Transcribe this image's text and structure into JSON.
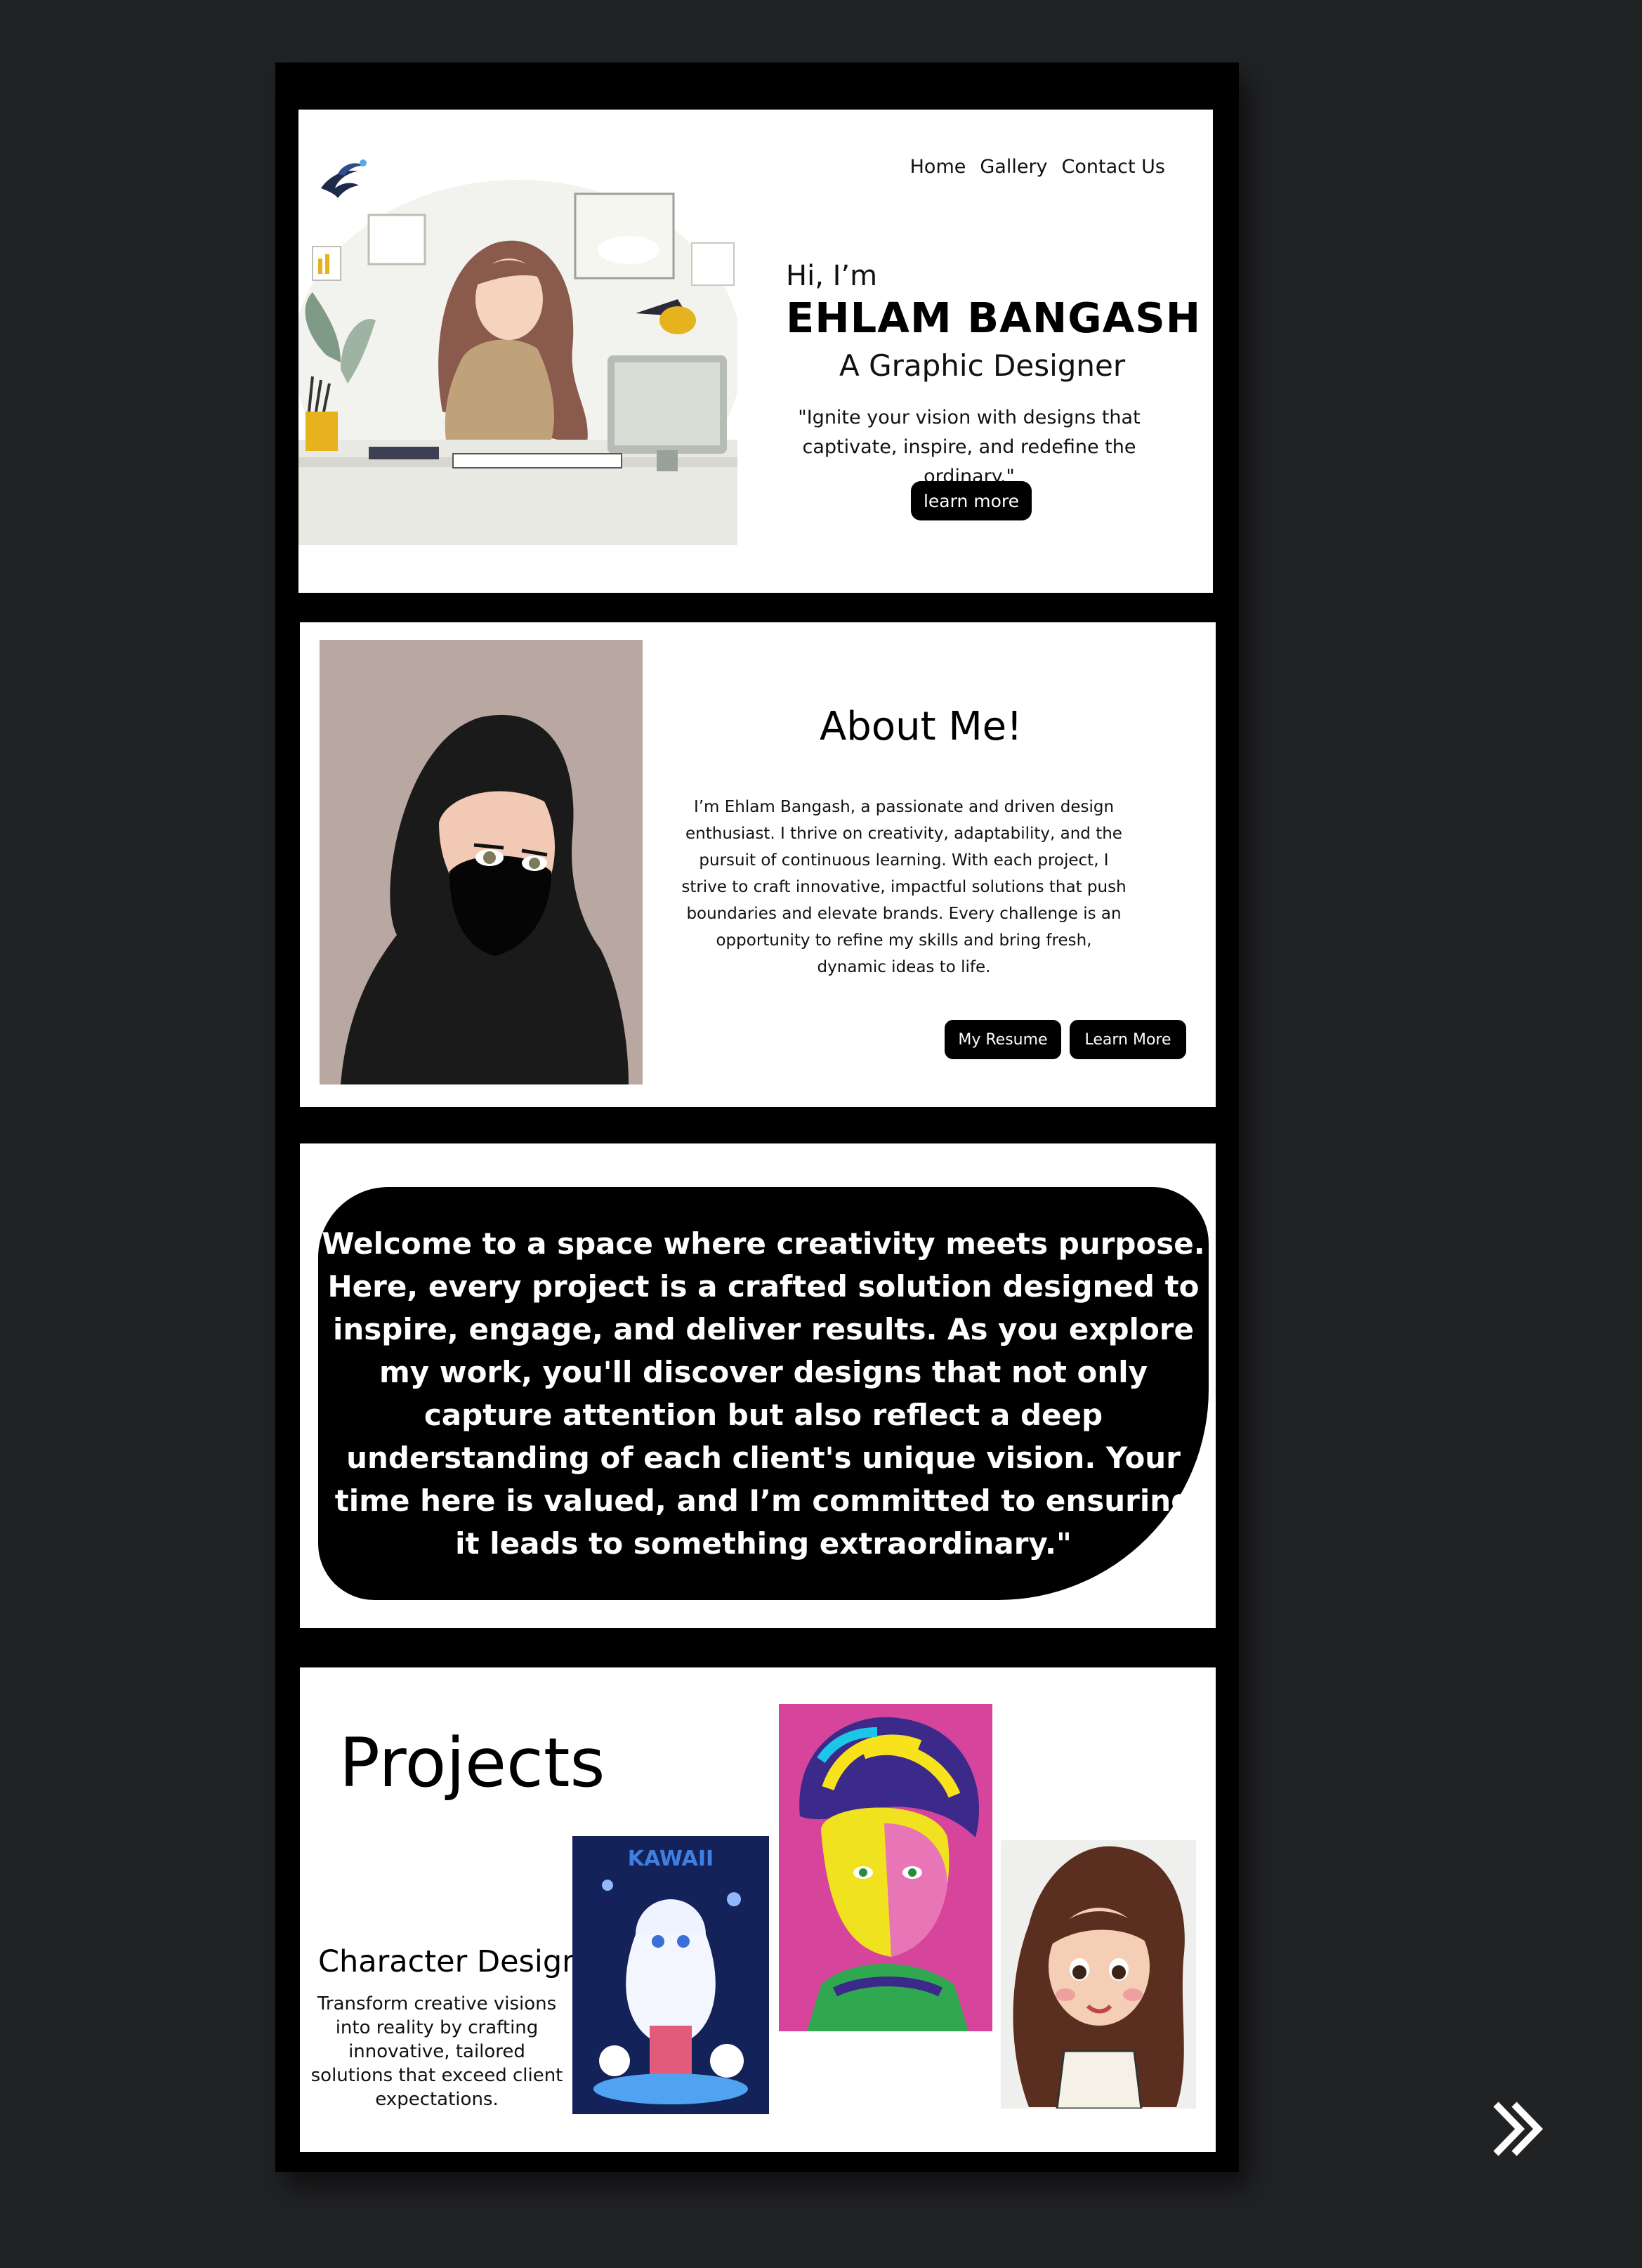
{
  "nav": {
    "items": [
      "Home",
      "Gallery",
      "Contact Us"
    ]
  },
  "hero": {
    "greeting": "Hi, I’m",
    "name": "EHLAM BANGASH",
    "role": "A Graphic Designer",
    "quote": "\"Ignite your vision with designs that captivate, inspire, and redefine the ordinary.\"",
    "button": "learn more"
  },
  "about": {
    "title": "About Me!",
    "text": "I’m Ehlam Bangash, a passionate and driven design enthusiast. I thrive on creativity, adaptability, and the pursuit of continuous learning. With each project, I strive to craft innovative, impactful solutions that push boundaries and elevate brands. Every challenge is an opportunity to refine my skills and bring fresh, dynamic ideas to life.",
    "resume_button": "My Resume",
    "learn_button": "Learn More"
  },
  "welcome": {
    "text": "Welcome to a space where creativity meets purpose. Here, every project is a crafted solution designed to inspire, engage, and deliver results. As you explore my work, you'll discover designs that not only capture attention but also reflect a deep understanding of each client's unique vision. Your time here is valued, and I’m committed to ensuring it leads to something extraordinary.\""
  },
  "projects": {
    "title": "Projects",
    "category_title": "Character Designs",
    "category_text": "Transform creative visions into reality by crafting innovative, tailored solutions that exceed client expectations.",
    "artwork_kawaii_text": "KAWAII"
  },
  "colors": {
    "background": "#212224",
    "frame": "#000000",
    "card": "#ffffff",
    "button": "#000000",
    "about_photo_bg": "#b9a7a2"
  },
  "icons": [
    "logo-icon",
    "next-arrow-icon"
  ]
}
